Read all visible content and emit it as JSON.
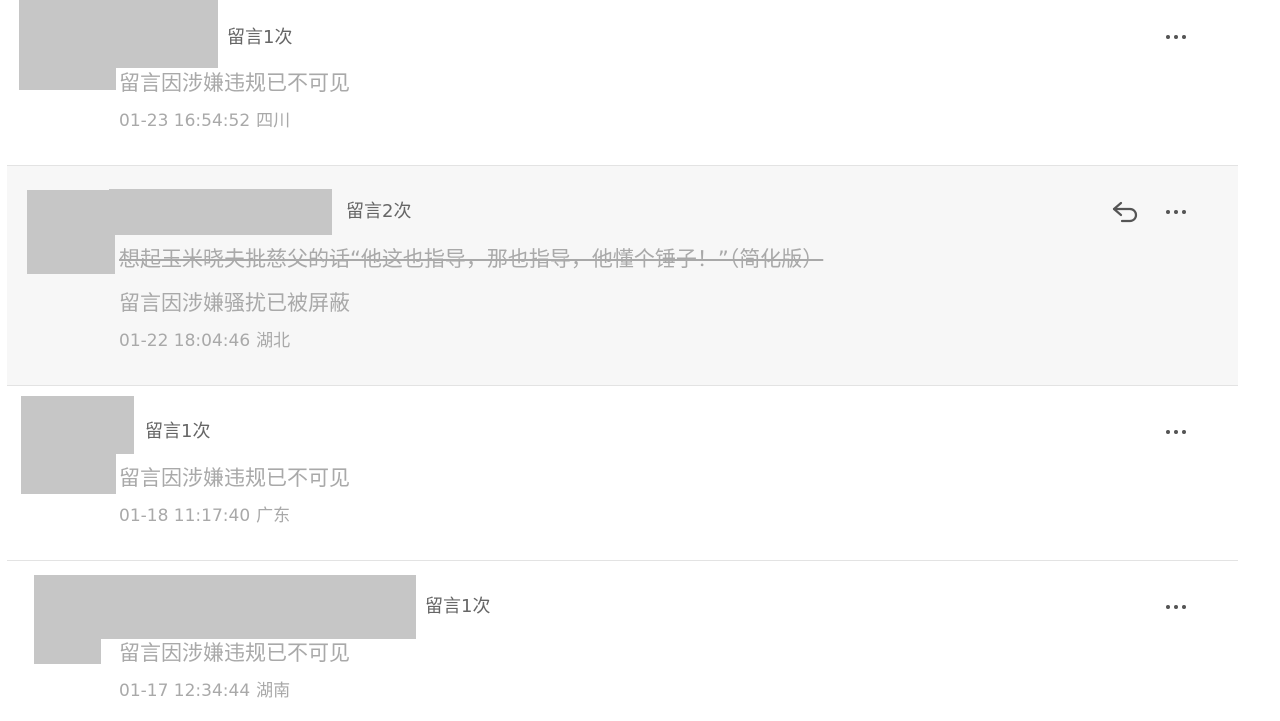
{
  "comments": [
    {
      "count_label": "留言1次",
      "messages": [
        "留言因涉嫌违规已不可见"
      ],
      "time": "01-23 16:54:52",
      "location": "四川"
    },
    {
      "count_label": "留言2次",
      "messages": [
        "想起玉米晓夫批慈父的话“他这也指导，那也指导，他懂个锤子！”（简化版）",
        "留言因涉嫌骚扰已被屏蔽"
      ],
      "time": "01-22 18:04:46",
      "location": "湖北"
    },
    {
      "count_label": "留言1次",
      "messages": [
        "留言因涉嫌违规已不可见"
      ],
      "time": "01-18 11:17:40",
      "location": "广东"
    },
    {
      "count_label": "留言1次",
      "messages": [
        "留言因涉嫌违规已不可见"
      ],
      "time": "01-17 12:34:44",
      "location": "湖南"
    }
  ],
  "icons": {
    "more": "more-icon",
    "reply": "reply-icon"
  },
  "colors": {
    "redaction": "#c6c6c6",
    "highlight_row": "#f7f7f7",
    "muted_text": "#a9a9a9"
  }
}
